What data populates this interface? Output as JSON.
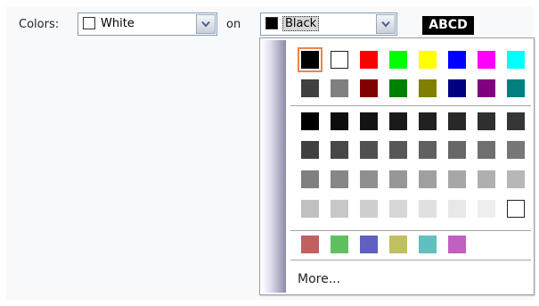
{
  "labels": {
    "colors": "Colors:",
    "on": "on"
  },
  "foreground": {
    "value": "White",
    "swatch": "#ffffff"
  },
  "background": {
    "value": "Black",
    "swatch": "#000000"
  },
  "preview": {
    "text": "ABCD",
    "fg": "#ffffff",
    "bg": "#000000"
  },
  "dropdown": {
    "selected": "#000000",
    "basic_rows": [
      [
        "#000000",
        "#ffffff",
        "#ff0000",
        "#00ff00",
        "#ffff00",
        "#0000ff",
        "#ff00ff",
        "#00ffff"
      ],
      [
        "#404040",
        "#808080",
        "#800000",
        "#008000",
        "#808000",
        "#000080",
        "#800080",
        "#008080"
      ]
    ],
    "gray_rows": [
      [
        "#000000",
        "#0d0d0d",
        "#131313",
        "#1a1a1a",
        "#212121",
        "#282828",
        "#2f2f2f",
        "#363636"
      ],
      [
        "#404040",
        "#474747",
        "#505050",
        "#575757",
        "#606060",
        "#676767",
        "#6f6f6f",
        "#777777"
      ],
      [
        "#808080",
        "#878787",
        "#8f8f8f",
        "#979797",
        "#a0a0a0",
        "#a7a7a7",
        "#afafaf",
        "#b7b7b7"
      ],
      [
        "#c0c0c0",
        "#c7c7c7",
        "#cfcfcf",
        "#d7d7d7",
        "#e0e0e0",
        "#e8e8e8",
        "#efefef",
        "#ffffff"
      ]
    ],
    "muted_row": [
      "#c06060",
      "#60c060",
      "#6060c0",
      "#c0c060",
      "#60c0c0",
      "#c060c0"
    ],
    "more_label": "More..."
  }
}
